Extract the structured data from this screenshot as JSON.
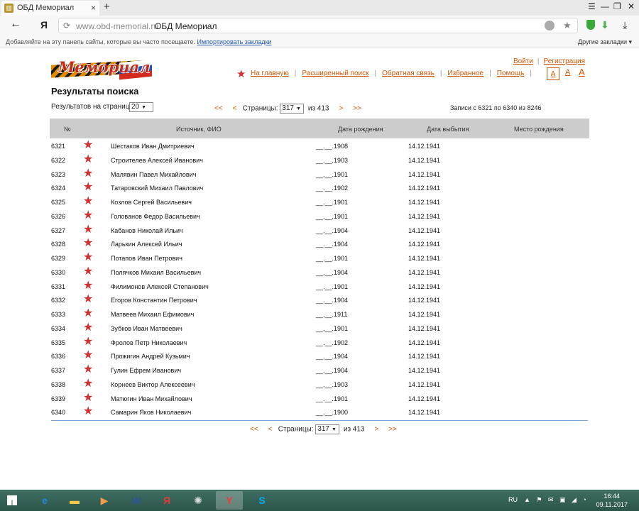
{
  "browser": {
    "tab_title": "ОБД Мемориал",
    "tab_close": "×",
    "new_tab": "+",
    "win_controls": [
      "☰",
      "—",
      "❐",
      "✕"
    ],
    "back": "←",
    "ya": "Я",
    "url_domain": "www.obd-memorial.ru",
    "url_page": "ОБД Мемориал",
    "bookmarks_hint": "Добавляйте на эту панель сайты, которые вы часто посещаете.",
    "bookmarks_import": "Импортировать закладки",
    "bookmarks_other": "Другие закладки ▾"
  },
  "site": {
    "logo_text": "Мемориал",
    "auth": {
      "login": "Войти",
      "register": "Регистрация"
    },
    "nav": [
      "На главную",
      "Расширенный поиск",
      "Обратная связь",
      "Избранное",
      "Помощь"
    ],
    "font_sizes": [
      "A",
      "A",
      "A"
    ]
  },
  "results": {
    "title": "Результаты поиска",
    "per_page_label": "Результатов на страницу:",
    "per_page_value": "20",
    "pager": {
      "first": "<<",
      "prev": "<",
      "label": "Страницы:",
      "current": "317",
      "of": "из 413",
      "next": ">",
      "last": ">>"
    },
    "records_info": "Записи с 6321 по 6340 из 8246",
    "columns": [
      "№",
      "Источник, ФИО",
      "Дата рождения",
      "Дата выбытия",
      "Место рождения"
    ],
    "rows": [
      {
        "num": "6321",
        "name": "Шестаков Иван Дмитриевич",
        "birth": "__.__.1908",
        "death": "14.12.1941"
      },
      {
        "num": "6322",
        "name": "Строителев Алексей Иванович",
        "birth": "__.__.1903",
        "death": "14.12.1941"
      },
      {
        "num": "6323",
        "name": "Малявин Павел Михайлович",
        "birth": "__.__.1901",
        "death": "14.12.1941"
      },
      {
        "num": "6324",
        "name": "Татаровский Михаил Павлович",
        "birth": "__.__.1902",
        "death": "14.12.1941"
      },
      {
        "num": "6325",
        "name": "Козлов Сергей Васильевич",
        "birth": "__.__.1901",
        "death": "14.12.1941"
      },
      {
        "num": "6326",
        "name": "Голованов Федор Васильевич",
        "birth": "__.__.1901",
        "death": "14.12.1941"
      },
      {
        "num": "6327",
        "name": "Кабанов Николай Ильич",
        "birth": "__.__.1904",
        "death": "14.12.1941"
      },
      {
        "num": "6328",
        "name": "Ларькин Алексей Ильич",
        "birth": "__.__.1904",
        "death": "14.12.1941"
      },
      {
        "num": "6329",
        "name": "Потапов Иван Петрович",
        "birth": "__.__.1901",
        "death": "14.12.1941"
      },
      {
        "num": "6330",
        "name": "Полячков Михаил Васильевич",
        "birth": "__.__.1904",
        "death": "14.12.1941"
      },
      {
        "num": "6331",
        "name": "Филимонов Алексей Степанович",
        "birth": "__.__.1901",
        "death": "14.12.1941"
      },
      {
        "num": "6332",
        "name": "Егоров Константин Петрович",
        "birth": "__.__.1904",
        "death": "14.12.1941"
      },
      {
        "num": "6333",
        "name": "Матвеев Михаил Ефимович",
        "birth": "__.__.1911",
        "death": "14.12.1941"
      },
      {
        "num": "6334",
        "name": "Зубков Иван Матвеевич",
        "birth": "__.__.1901",
        "death": "14.12.1941"
      },
      {
        "num": "6335",
        "name": "Фролов Петр Николаевич",
        "birth": "__.__.1902",
        "death": "14.12.1941"
      },
      {
        "num": "6336",
        "name": "Прожигин Андрей Кузьмич",
        "birth": "__.__.1904",
        "death": "14.12.1941"
      },
      {
        "num": "6337",
        "name": "Гулин Ефрем Иванович",
        "birth": "__.__.1904",
        "death": "14.12.1941"
      },
      {
        "num": "6338",
        "name": "Корнеев Виктор Алексеевич",
        "birth": "__.__.1903",
        "death": "14.12.1941"
      },
      {
        "num": "6339",
        "name": "Матюгин Иван Михайлович",
        "birth": "__.__.1901",
        "death": "14.12.1941"
      },
      {
        "num": "6340",
        "name": "Самарин Яков Николаевич",
        "birth": "__.__.1900",
        "death": "14.12.1941"
      }
    ]
  },
  "taskbar": {
    "apps": [
      {
        "icon": "ie-icon",
        "glyph": "e",
        "color": "#1e88e5"
      },
      {
        "icon": "explorer-icon",
        "glyph": "▬",
        "color": "#f2c94c"
      },
      {
        "icon": "media-player-icon",
        "glyph": "▶",
        "color": "#f2994a"
      },
      {
        "icon": "word-icon",
        "glyph": "W",
        "color": "#2b579a"
      },
      {
        "icon": "yandex-app-icon",
        "glyph": "Я",
        "color": "#e53935"
      },
      {
        "icon": "film-icon",
        "glyph": "✺",
        "color": "#dddddd"
      },
      {
        "icon": "yandex-browser-icon",
        "glyph": "Y",
        "color": "#ff3333"
      },
      {
        "icon": "skype-icon",
        "glyph": "S",
        "color": "#00aff0"
      }
    ],
    "lang": "RU",
    "tray_icons": "▲ ⚑ ✉ ▣ ◢ ◔",
    "time": "16:44",
    "date": "09.11.2017"
  }
}
